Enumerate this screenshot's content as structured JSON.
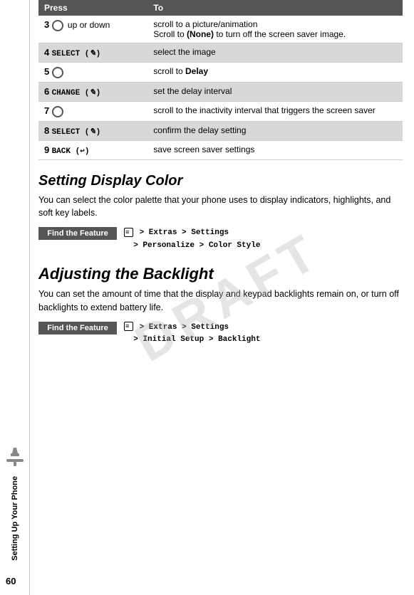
{
  "sidebar": {
    "label": "Setting Up Your Phone",
    "page_number": "60"
  },
  "table": {
    "headers": [
      "Press",
      "To"
    ],
    "rows": [
      {
        "num": "3",
        "press_type": "nav",
        "press_text": "up or down",
        "to_lines": [
          "scroll to a picture/animation",
          "Scroll to (None) to turn off the screen saver image."
        ],
        "shaded": false
      },
      {
        "num": "4",
        "press_type": "code",
        "press_text": "SELECT (",
        "press_icon": "✎",
        "press_suffix": ")",
        "to_lines": [
          "select the image"
        ],
        "shaded": true
      },
      {
        "num": "5",
        "press_type": "nav",
        "press_text": "",
        "to_lines": [
          "scroll to Delay"
        ],
        "to_bold": "Delay",
        "shaded": false
      },
      {
        "num": "6",
        "press_type": "code",
        "press_text": "CHANGE (",
        "press_icon": "✎",
        "press_suffix": ")",
        "to_lines": [
          "set the delay interval"
        ],
        "shaded": true
      },
      {
        "num": "7",
        "press_type": "nav",
        "press_text": "",
        "to_lines": [
          "scroll to the inactivity interval that triggers the screen saver"
        ],
        "shaded": false
      },
      {
        "num": "8",
        "press_type": "code",
        "press_text": "SELECT (",
        "press_icon": "✎",
        "press_suffix": ")",
        "to_lines": [
          "confirm the delay setting"
        ],
        "shaded": true
      },
      {
        "num": "9",
        "press_type": "code",
        "press_text": "BACK (",
        "press_icon": "↩",
        "press_suffix": ")",
        "to_lines": [
          "save screen saver settings"
        ],
        "shaded": false
      }
    ]
  },
  "setting_display_color": {
    "heading": "Setting Display Color",
    "body": "You can select the color palette that your phone uses to display indicators, highlights, and soft key labels.",
    "find_feature_label": "Find the Feature",
    "find_feature_path_line1": "> Extras > Settings",
    "find_feature_path_line2": "> Personalize > Color Style"
  },
  "adjusting_backlight": {
    "heading": "Adjusting the Backlight",
    "body": "You can set the amount of time that the display and keypad backlights remain on, or turn off backlights to extend battery life.",
    "find_feature_label": "Find the Feature",
    "find_feature_path_line1": "> Extras > Settings",
    "find_feature_path_line2": "> Initial Setup > Backlight"
  },
  "watermark": "DRAFT"
}
